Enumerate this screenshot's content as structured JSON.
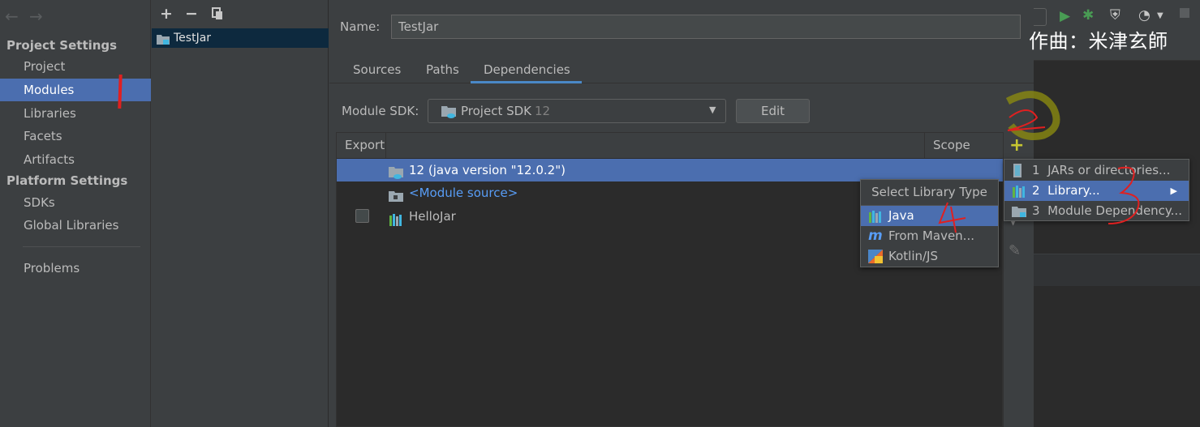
{
  "sidebar": {
    "project_settings_title": "Project Settings",
    "project_items": [
      "Project",
      "Modules",
      "Libraries",
      "Facets",
      "Artifacts"
    ],
    "platform_settings_title": "Platform Settings",
    "platform_items": [
      "SDKs",
      "Global Libraries"
    ],
    "problems_label": "Problems",
    "selected_item": "Modules"
  },
  "module_list": {
    "toolbar_icons": [
      "add-icon",
      "remove-icon",
      "copy-icon"
    ],
    "modules": [
      "TestJar"
    ]
  },
  "main": {
    "name_label": "Name:",
    "name_value": "TestJar",
    "tabs": [
      "Sources",
      "Paths",
      "Dependencies"
    ],
    "active_tab": "Dependencies",
    "sdk_label": "Module SDK:",
    "sdk_value": "Project SDK",
    "sdk_version": "12",
    "edit_label": "Edit",
    "table": {
      "headers": [
        "Export",
        "Scope"
      ],
      "rows": [
        {
          "label": "12 (java version \"12.0.2\")",
          "icon": "jdk-folder-icon"
        },
        {
          "label": "<Module source>",
          "icon": "folder-icon"
        },
        {
          "label": "HelloJar",
          "icon": "library-icon",
          "checkbox": false
        }
      ]
    }
  },
  "add_menu": {
    "items": [
      "1  JARs or directories...",
      "2  Library...",
      "3  Module Dependency..."
    ],
    "selected_index": 1
  },
  "library_type_popup": {
    "title": "Select Library Type",
    "items": [
      "Java",
      "From Maven...",
      "Kotlin/JS"
    ],
    "selected_index": 0
  },
  "overlay": {
    "caption": "作曲：米津玄師",
    "annotations": [
      "1",
      "2",
      "3",
      "4"
    ]
  },
  "colors": {
    "selection": "#4b6eaf",
    "background": "#3c3f41",
    "table_background": "#2b2b2b",
    "add_icon": "#c7c731",
    "annotation": "#e02020"
  }
}
